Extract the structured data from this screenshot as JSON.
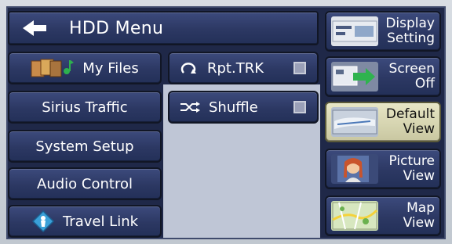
{
  "header": {
    "title": "HDD Menu"
  },
  "left_buttons": [
    {
      "label": "My Files",
      "icon": "my-files-icon"
    },
    {
      "label": "Sirius Traffic"
    },
    {
      "label": "System Setup"
    },
    {
      "label": "Audio Control"
    },
    {
      "label": "Travel Link",
      "icon": "travel-link-icon"
    }
  ],
  "mid_buttons": [
    {
      "label": "Rpt.TRK",
      "icon": "repeat-icon",
      "checked": false
    },
    {
      "label": "Shuffle",
      "icon": "shuffle-icon",
      "checked": false
    }
  ],
  "right_buttons": [
    {
      "label": "Display\nSetting",
      "icon": "display-setting-icon"
    },
    {
      "label": "Screen\nOff",
      "icon": "screen-off-icon"
    },
    {
      "label": "Default\nView",
      "icon": "default-view-icon",
      "active": true
    },
    {
      "label": "Picture\nView",
      "icon": "picture-view-icon"
    },
    {
      "label": "Map\nView",
      "icon": "map-view-icon"
    }
  ],
  "colors": {
    "button_bg": "#2c3863",
    "active_bg": "#dcdab6",
    "screen_bg": "#1f2848",
    "panel_bg": "#bfc6d6"
  }
}
